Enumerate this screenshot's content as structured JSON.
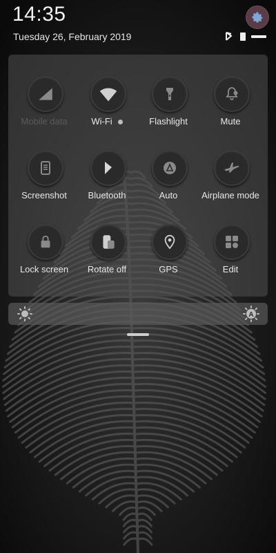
{
  "status": {
    "time": "14:35",
    "date": "Tuesday 26, February 2019"
  },
  "quick_settings": {
    "tiles": [
      {
        "id": "data",
        "label": "Mobile data",
        "icon": "signal-icon",
        "active": false
      },
      {
        "id": "wifi",
        "label": "Wi-Fi",
        "icon": "wifi-icon",
        "active": true
      },
      {
        "id": "flashlight",
        "label": "Flashlight",
        "icon": "flashlight-icon",
        "active": false
      },
      {
        "id": "mute",
        "label": "Mute",
        "icon": "bell-icon",
        "active": false
      },
      {
        "id": "screenshot",
        "label": "Screenshot",
        "icon": "screenshot-icon",
        "active": false
      },
      {
        "id": "bluetooth",
        "label": "Bluetooth",
        "icon": "bluetooth-icon",
        "active": true
      },
      {
        "id": "auto",
        "label": "Auto",
        "icon": "auto-brightness-icon",
        "active": false
      },
      {
        "id": "airplane",
        "label": "Airplane mode",
        "icon": "airplane-icon",
        "active": false
      },
      {
        "id": "lock",
        "label": "Lock screen",
        "icon": "lock-icon",
        "active": false
      },
      {
        "id": "rotate",
        "label": "Rotate off",
        "icon": "rotate-icon",
        "active": false
      },
      {
        "id": "gps",
        "label": "GPS",
        "icon": "location-pin-icon",
        "active": false
      },
      {
        "id": "edit",
        "label": "Edit",
        "icon": "edit-grid-icon",
        "active": false
      }
    ]
  },
  "brightness": {
    "level": 0,
    "auto_label": "A"
  },
  "colors": {
    "accent_settings": "#5a3c49",
    "panel": "#505050",
    "tile_bg": "#2a2a2a"
  }
}
